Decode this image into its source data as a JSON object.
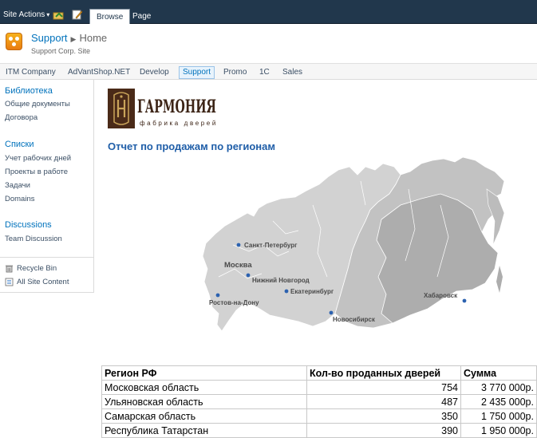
{
  "ribbon": {
    "site_actions": "Site Actions",
    "tabs": [
      "Browse",
      "Page"
    ]
  },
  "site": {
    "title": "Support",
    "breadcrumb": "Home",
    "description": "Support Corp. Site"
  },
  "topnav": {
    "items": [
      "ITM Company",
      "AdVantShop.NET",
      "Develop",
      "Support",
      "Promo",
      "1C",
      "Sales"
    ],
    "selected": "Support"
  },
  "quicklaunch": {
    "libraries": {
      "header": "Библиотека",
      "items": [
        "Общие документы",
        "Договора"
      ]
    },
    "lists": {
      "header": "Списки",
      "items": [
        "Учет рабочих дней",
        "Проекты в работе",
        "Задачи",
        "Domains"
      ]
    },
    "discussions": {
      "header": "Discussions",
      "items": [
        "Team Discussion"
      ]
    },
    "footer": {
      "recycle_bin": "Recycle Bin",
      "all_site_content": "All Site Content"
    }
  },
  "brand": {
    "name": "ГАРМОНИЯ",
    "tagline": "фабрика дверей"
  },
  "report": {
    "title": "Отчет по продажам по регионам"
  },
  "map": {
    "cities": {
      "spb": "Санкт-Петербург",
      "moscow": "Москва",
      "nn": "Нижний Новгород",
      "rostov": "Ростов-на-Дону",
      "ekb": "Екатеринбург",
      "nsk": "Новосибирск",
      "khab": "Хабаровск"
    },
    "colors": {
      "land_light": "#d2d2d2",
      "land_mid": "#c2c2c2",
      "land_dark": "#adadad",
      "dot": "#2c62b0"
    }
  },
  "table": {
    "headers": [
      "Регион РФ",
      "Кол-во проданных дверей",
      "Сумма"
    ],
    "rows": [
      [
        "Московская область",
        "754",
        "3 770 000р."
      ],
      [
        "Ульяновская область",
        "487",
        "2 435 000р."
      ],
      [
        "Самарская область",
        "350",
        "1 750 000р."
      ],
      [
        "Республика Татарстан",
        "390",
        "1 950 000р."
      ]
    ]
  },
  "colors": {
    "ribbon_bg": "#21374c",
    "link": "#0072bc",
    "title": "#1f5ea8",
    "logo_brown": "#4a2a18",
    "logo_gold": "#c9a45a"
  }
}
